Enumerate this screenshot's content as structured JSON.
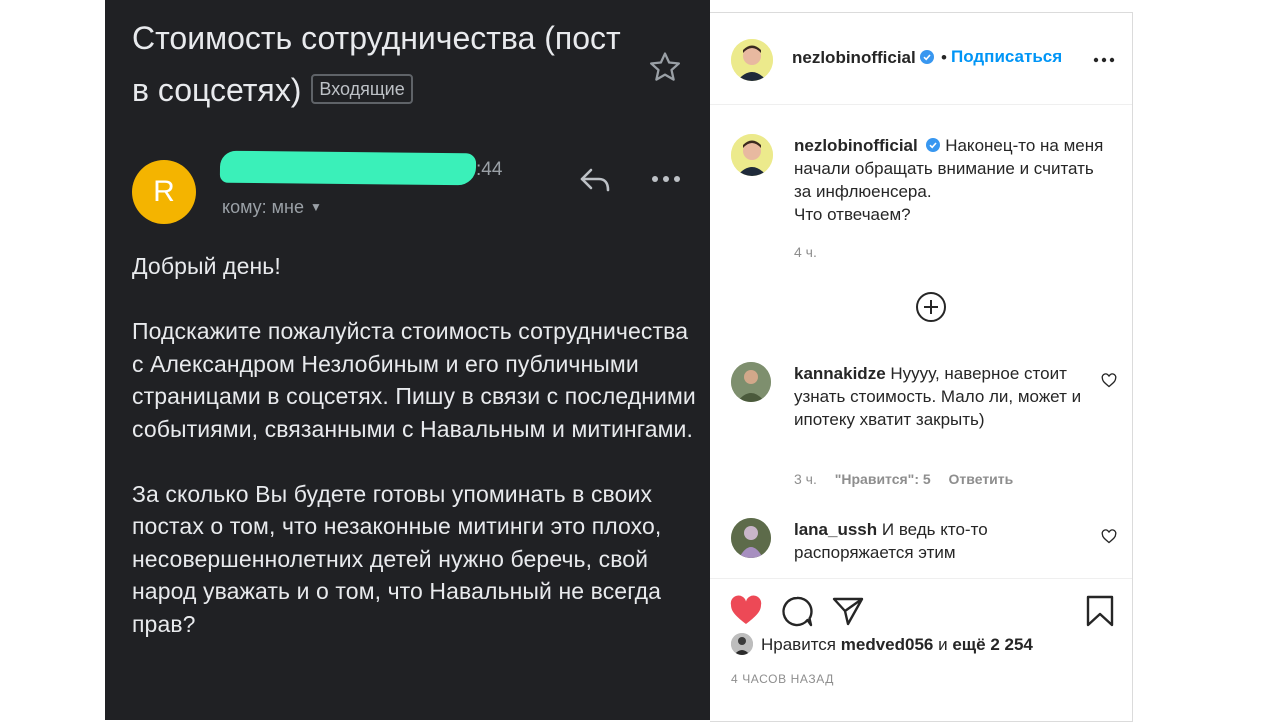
{
  "email": {
    "subject": "Стоимость сотрудничества (пост в соцсетях)",
    "label_badge": "Входящие",
    "sender_initial": "R",
    "time_partial": ":44",
    "recipient": "кому: мне",
    "body": [
      "Добрый день!",
      "Подскажите пожалуйста стоимость сотрудничества с Александром Незлобиным и его публичными страницами в соцсетях. Пишу в связи с последними событиями, связанными с Навальным и митингами.",
      "За сколько Вы будете готовы упоминать в своих постах о том, что незаконные митинги это плохо, несовершеннолетних детей нужно беречь, свой народ уважать и о том, что Навальный не всегда прав?"
    ],
    "colors": {
      "background": "#202124",
      "avatar": "#f4b400",
      "redaction": "#3af0b9"
    }
  },
  "instagram": {
    "header": {
      "username": "nezlobinofficial",
      "separator": "•",
      "follow": "Подписаться"
    },
    "caption": {
      "username": "nezlobinofficial",
      "text": "Наконец-то на меня начали обращать внимание и считать за инфлюенсера.",
      "text2": "Что отвечаем?",
      "time": "4 ч."
    },
    "comments": [
      {
        "username": "kannakidze",
        "text": "Нуууу, наверное стоит узнать стоимость. Мало ли, может и ипотеку хватит закрыть)",
        "time": "3 ч.",
        "likes": "\"Нравится\": 5",
        "reply": "Ответить"
      },
      {
        "username": "lana_ussh",
        "text": "И ведь кто-то распоряжается этим"
      }
    ],
    "likes": {
      "prefix": "Нравится",
      "user": "medved056",
      "joiner": "и",
      "others": "ещё 2 254"
    },
    "post_time": "4 часов назад",
    "colors": {
      "link": "#0095f6",
      "heart": "#ed4956",
      "verified": "#3897f0"
    }
  }
}
